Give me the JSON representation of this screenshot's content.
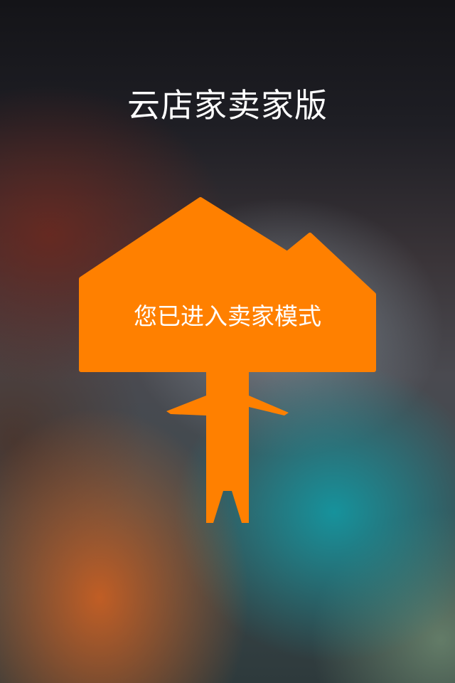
{
  "app": {
    "title": "云店家卖家版"
  },
  "mascot": {
    "icon": "house-signpost-icon",
    "message": "您已进入卖家模式"
  },
  "colors": {
    "accent": "#FF8000",
    "text": "#FFFFFF"
  }
}
